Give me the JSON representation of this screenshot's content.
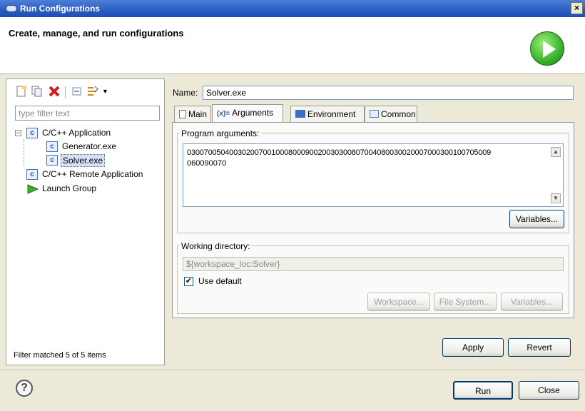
{
  "window": {
    "title": "Run Configurations",
    "close_label": "×"
  },
  "header": {
    "title": "Create, manage, and run configurations"
  },
  "left": {
    "filter_placeholder": "type filter text",
    "tree": {
      "cpp_app": "C/C++ Application",
      "generator": "Generator.exe",
      "solver": "Solver.exe",
      "cpp_remote": "C/C++ Remote Application",
      "launch_group": "Launch Group"
    },
    "status": "Filter matched 5 of 5 items"
  },
  "right": {
    "name_label": "Name:",
    "name_value": "Solver.exe",
    "tabs": [
      "Main",
      "Arguments",
      "Environment",
      "Common"
    ],
    "program_args_label": "Program arguments:",
    "program_args_line1": "03007005040030200700100080009002003030080700408003002000700030010070500​9",
    "program_args_line2": "060090070",
    "variables_label": "Variables...",
    "working_dir_label": "Working directory:",
    "working_dir_value": "${workspace_loc:Solver}",
    "use_default_label": "Use default",
    "workspace_label": "Workspace...",
    "file_system_label": "File System...",
    "variables2_label": "Variables...",
    "apply_label": "Apply",
    "revert_label": "Revert"
  },
  "bottom": {
    "help_label": "?",
    "run_label": "Run",
    "close_label": "Close"
  }
}
